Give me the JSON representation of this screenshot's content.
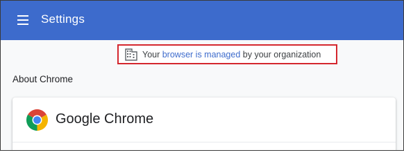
{
  "toolbar": {
    "title": "Settings",
    "menu_icon": "hamburger-menu-icon",
    "background": "#3d6bcc"
  },
  "managed_notice": {
    "icon": "building-icon",
    "prefix": "Your ",
    "link": "browser is managed",
    "suffix": " by your organization",
    "highlight_color": "#d4262d"
  },
  "about": {
    "section_title": "About Chrome",
    "product_name": "Google Chrome",
    "logo_icon": "chrome-logo-icon"
  }
}
